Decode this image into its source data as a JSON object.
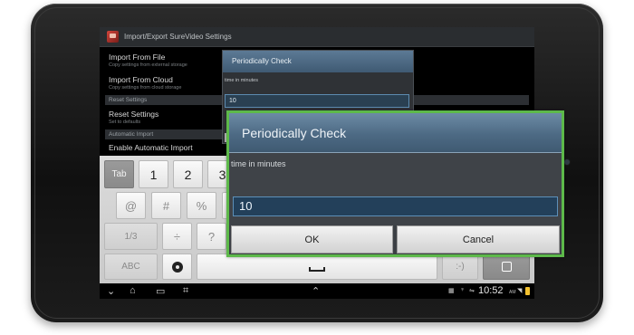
{
  "screen": {
    "title": "Import/Export SureVideo Settings",
    "preferences": [
      {
        "title": "Import From File",
        "subtitle": "Copy settings from external storage"
      },
      {
        "title": "Import From Cloud",
        "subtitle": "Copy settings from cloud storage"
      }
    ],
    "categories": [
      "Reset Settings",
      "Automatic Import"
    ],
    "reset_item": {
      "title": "Reset Settings",
      "subtitle": "Set to defaults"
    },
    "auto_import_item": {
      "title": "Enable Automatic Import"
    }
  },
  "background_dialog": {
    "title": "Periodically Check",
    "label": "time in minutes",
    "value": "10"
  },
  "keyboard": {
    "row1": [
      "Tab",
      "1",
      "2",
      "3"
    ],
    "row2": [
      "@",
      "#",
      "%"
    ],
    "row3": [
      "1/3",
      "÷",
      "?"
    ],
    "row4": [
      "ABC",
      "gear-icon",
      "space",
      ":-)",
      "mic-icon"
    ]
  },
  "statusbar": {
    "time": "10:52",
    "ampm": "AM"
  },
  "zoom_dialog": {
    "title": "Periodically Check",
    "label": "time in minutes",
    "value": "10",
    "ok_label": "OK",
    "cancel_label": "Cancel"
  },
  "colors": {
    "highlight_border": "#5db94a",
    "dialog_title": "#4d6a84",
    "input_bg": "#23405a"
  }
}
